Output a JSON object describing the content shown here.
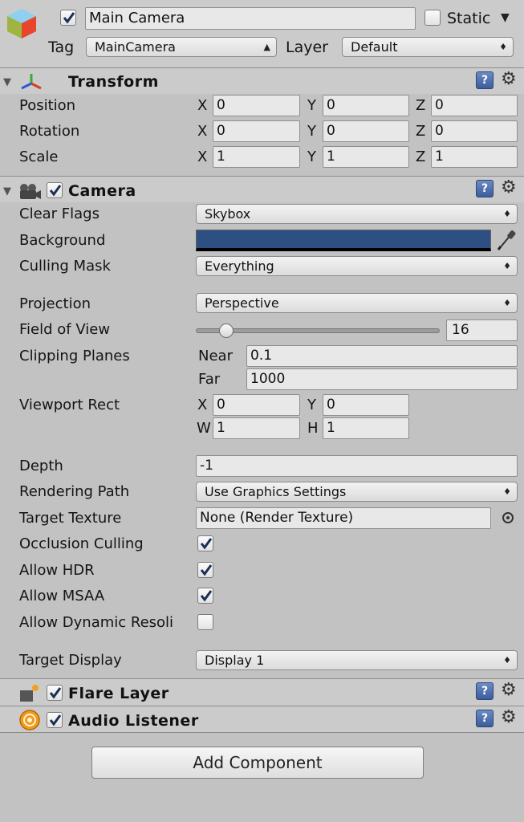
{
  "header": {
    "name": "Main Camera",
    "active": true,
    "static_label": "Static",
    "static_checked": false,
    "tag_label": "Tag",
    "tag_value": "MainCamera",
    "layer_label": "Layer",
    "layer_value": "Default"
  },
  "transform": {
    "title": "Transform",
    "rows": [
      {
        "label": "Position",
        "x": "0",
        "y": "0",
        "z": "0"
      },
      {
        "label": "Rotation",
        "x": "0",
        "y": "0",
        "z": "0"
      },
      {
        "label": "Scale",
        "x": "1",
        "y": "1",
        "z": "1"
      }
    ],
    "axis": {
      "x": "X",
      "y": "Y",
      "z": "Z"
    }
  },
  "camera": {
    "title": "Camera",
    "enabled": true,
    "clear_flags_label": "Clear Flags",
    "clear_flags_value": "Skybox",
    "background_label": "Background",
    "background_color": "#2e4f82",
    "culling_mask_label": "Culling Mask",
    "culling_mask_value": "Everything",
    "projection_label": "Projection",
    "projection_value": "Perspective",
    "fov_label": "Field of View",
    "fov_value": "16",
    "fov_fraction": 0.1,
    "clipping_label": "Clipping Planes",
    "near_label": "Near",
    "near_value": "0.1",
    "far_label": "Far",
    "far_value": "1000",
    "viewport_label": "Viewport Rect",
    "vp_x_label": "X",
    "vp_x": "0",
    "vp_y_label": "Y",
    "vp_y": "0",
    "vp_w_label": "W",
    "vp_w": "1",
    "vp_h_label": "H",
    "vp_h": "1",
    "depth_label": "Depth",
    "depth_value": "-1",
    "rendering_path_label": "Rendering Path",
    "rendering_path_value": "Use Graphics Settings",
    "target_texture_label": "Target Texture",
    "target_texture_value": "None (Render Texture)",
    "occlusion_label": "Occlusion Culling",
    "occlusion_checked": true,
    "hdr_label": "Allow HDR",
    "hdr_checked": true,
    "msaa_label": "Allow MSAA",
    "msaa_checked": true,
    "dynres_label": "Allow Dynamic Resoli",
    "dynres_checked": false,
    "target_display_label": "Target Display",
    "target_display_value": "Display 1"
  },
  "flare": {
    "title": "Flare Layer",
    "enabled": true
  },
  "audio": {
    "title": "Audio Listener",
    "enabled": true
  },
  "add_component_label": "Add Component",
  "icons": {
    "cube": "cube-icon",
    "transform": "transform-axes-icon",
    "camera": "camera-icon",
    "flare": "flare-layer-icon",
    "audio": "audio-listener-icon",
    "help": "help-book-icon",
    "gear": "gear-icon",
    "picker": "eyedropper-icon",
    "object_picker": "object-picker-icon",
    "foldout": "foldout-triangle-icon",
    "check": "checkmark-icon"
  }
}
